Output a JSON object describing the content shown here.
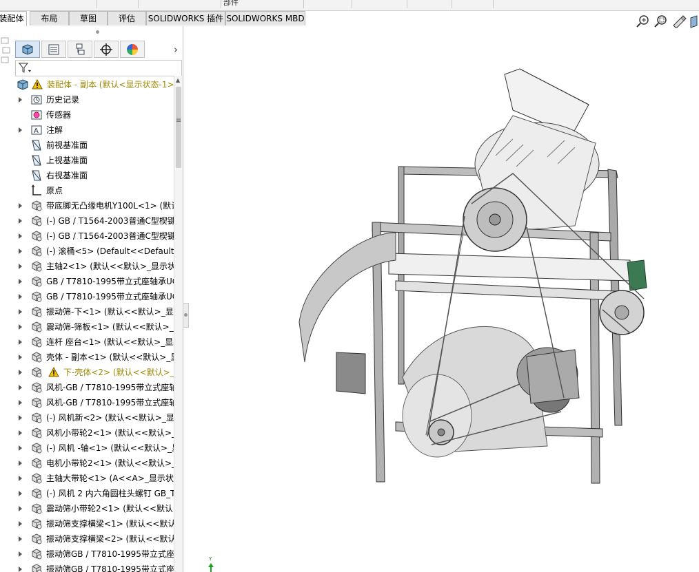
{
  "top_menu": {
    "partial_label": "部件"
  },
  "tabs": [
    {
      "label": "装配体",
      "active": true
    },
    {
      "label": "布局",
      "active": false
    },
    {
      "label": "草图",
      "active": false
    },
    {
      "label": "评估",
      "active": false
    },
    {
      "label": "SOLIDWORKS 插件",
      "active": false
    },
    {
      "label": "SOLIDWORKS MBD",
      "active": false
    }
  ],
  "panel_tabs": [
    {
      "icon": "feature-manager-icon"
    },
    {
      "icon": "property-manager-icon"
    },
    {
      "icon": "configuration-manager-icon"
    },
    {
      "icon": "dimxpert-icon"
    },
    {
      "icon": "display-manager-icon"
    }
  ],
  "tree": {
    "root": "装配体 - 副本  (默认<显示状态-1>",
    "items": [
      {
        "label": "历史记录",
        "icon": "history-icon",
        "expandable": true
      },
      {
        "label": "传感器",
        "icon": "sensor-icon",
        "expandable": false
      },
      {
        "label": "注解",
        "icon": "annotation-icon",
        "expandable": true
      },
      {
        "label": "前视基准面",
        "icon": "plane-icon",
        "expandable": false
      },
      {
        "label": "上视基准面",
        "icon": "plane-icon",
        "expandable": false
      },
      {
        "label": "右视基准面",
        "icon": "plane-icon",
        "expandable": false
      },
      {
        "label": "原点",
        "icon": "origin-icon",
        "expandable": false
      },
      {
        "label": "带底脚无凸缘电机Y100L<1> (默认",
        "icon": "part-icon",
        "expandable": true
      },
      {
        "label": "(-) GB / T1564-2003普通C型楔键",
        "icon": "part-icon",
        "expandable": true
      },
      {
        "label": "(-) GB / T1564-2003普通C型楔键",
        "icon": "part-icon",
        "expandable": true
      },
      {
        "label": "(-) 滚桶<5> (Default<<Default>",
        "icon": "part-icon",
        "expandable": true
      },
      {
        "label": "主轴2<1> (默认<<默认>_显示状",
        "icon": "part-icon",
        "expandable": true
      },
      {
        "label": "GB / T7810-1995带立式座轴承UC",
        "icon": "part-icon",
        "expandable": true
      },
      {
        "label": "GB / T7810-1995带立式座轴承UC",
        "icon": "part-icon",
        "expandable": true
      },
      {
        "label": "振动筛-下<1> (默认<<默认>_显示",
        "icon": "part-icon",
        "expandable": true
      },
      {
        "label": "震动筛-筛板<1> (默认<<默认>_显",
        "icon": "part-icon",
        "expandable": true
      },
      {
        "label": "连杆 座台<1> (默认<<默认>_显示",
        "icon": "part-icon",
        "expandable": true
      },
      {
        "label": "壳体 - 副本<1> (默认<<默认>_显",
        "icon": "part-icon",
        "expandable": true
      },
      {
        "label": "下-壳体<2> (默认<<默认>_显",
        "icon": "part-icon",
        "expandable": true,
        "warning": true
      },
      {
        "label": "风机-GB / T7810-1995带立式座轴",
        "icon": "part-icon",
        "expandable": true
      },
      {
        "label": "风机-GB / T7810-1995带立式座轴",
        "icon": "part-icon",
        "expandable": true
      },
      {
        "label": "(-) 风机新<2> (默认<<默认>_显示",
        "icon": "part-icon",
        "expandable": true
      },
      {
        "label": "风机小带轮2<1> (默认<<默认>_显",
        "icon": "part-icon",
        "expandable": true
      },
      {
        "label": "(-) 风机 -轴<1> (默认<<默认>_显",
        "icon": "part-icon",
        "expandable": true
      },
      {
        "label": "电机小带轮2<1> (默认<<默认>_显",
        "icon": "part-icon",
        "expandable": true
      },
      {
        "label": "主轴大带轮<1> (A<<A>_显示状态",
        "icon": "part-icon",
        "expandable": true
      },
      {
        "label": "(-) 风机 2 内六角圆柱头螺钉 GB_T",
        "icon": "part-icon",
        "expandable": true
      },
      {
        "label": "震动筛小带轮2<1> (默认<<默认>",
        "icon": "part-icon",
        "expandable": true
      },
      {
        "label": "振动筛支撑横梁<1> (默认<<默认",
        "icon": "part-icon",
        "expandable": true
      },
      {
        "label": "振动筛支撑横梁<2> (默认<<默认",
        "icon": "part-icon",
        "expandable": true
      },
      {
        "label": "振动筛GB / T7810-1995带立式座",
        "icon": "part-icon",
        "expandable": true
      },
      {
        "label": "振动筛GB / T7810-1995带立式座",
        "icon": "part-icon",
        "expandable": true
      }
    ]
  },
  "viewport": {
    "hud_icons": [
      "zoom-to-fit-icon",
      "zoom-to-area-icon",
      "previous-view-icon",
      "section-view-icon"
    ],
    "triad_label": "Y"
  }
}
